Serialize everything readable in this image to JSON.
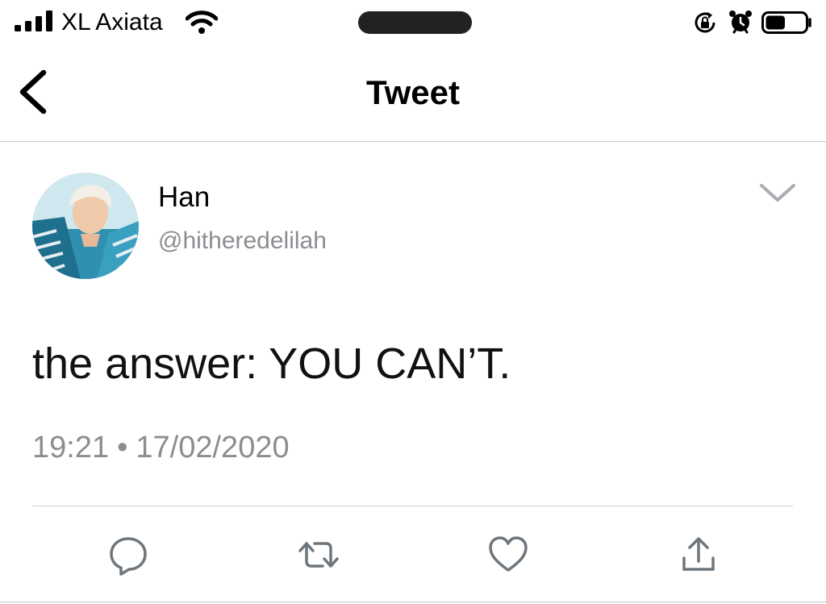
{
  "status_bar": {
    "carrier": "XL Axiata",
    "icons": [
      "signal-icon",
      "wifi-icon",
      "rotation-lock-icon",
      "alarm-icon",
      "battery-icon"
    ],
    "battery_level": 0.5
  },
  "nav": {
    "title": "Tweet",
    "back_icon": "chevron-left-icon"
  },
  "tweet": {
    "author": {
      "name": "Han",
      "handle": "@hitheredelilah"
    },
    "text": "the answer: YOU CAN’T.",
    "time": "19:21",
    "separator": "•",
    "date": "17/02/2020",
    "menu_icon": "chevron-down-icon"
  },
  "actions": [
    {
      "icon": "reply-icon"
    },
    {
      "icon": "retweet-icon"
    },
    {
      "icon": "like-icon"
    },
    {
      "icon": "share-icon"
    }
  ],
  "colors": {
    "text": "#000000",
    "secondary_text": "#8a8d91",
    "divider": "#c9ccd1",
    "action_icon": "#6e767d",
    "notch": "#222222"
  }
}
